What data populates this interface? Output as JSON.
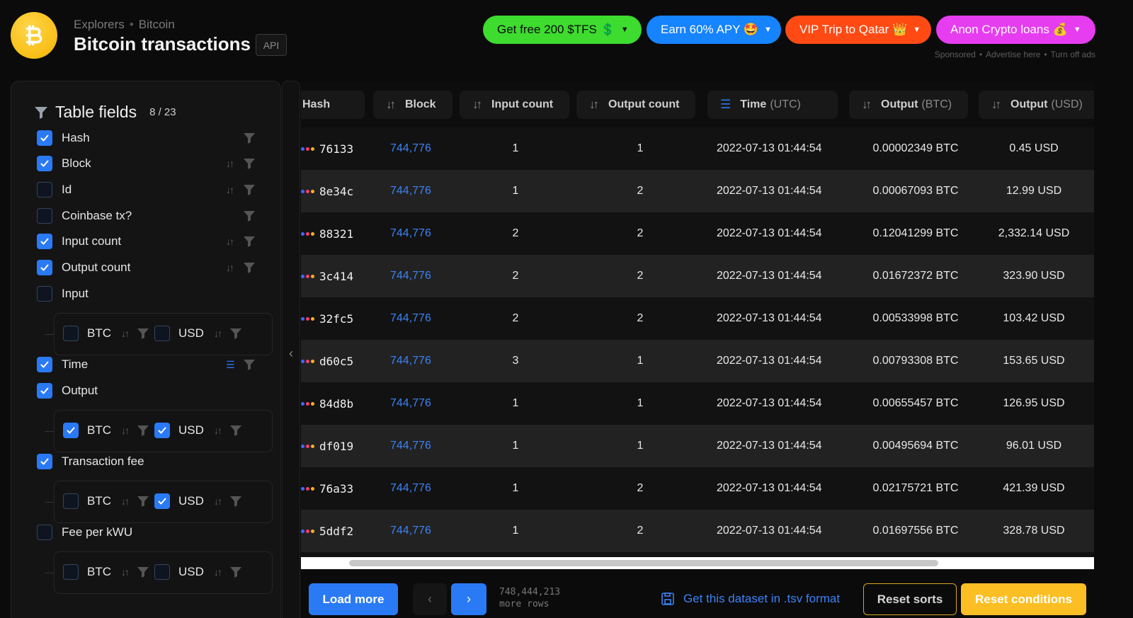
{
  "header": {
    "breadcrumb": [
      "Explorers",
      "Bitcoin"
    ],
    "title": "Bitcoin transactions",
    "api_label": "API"
  },
  "ads": [
    {
      "label": "Get free 200 $TFS 💲",
      "bg": "#3ddc2f",
      "color": "#0b0b0b"
    },
    {
      "label": "Earn 60% APY 🤩",
      "bg": "#1683ff",
      "color": "#ffffff"
    },
    {
      "label": "VIP Trip to Qatar 👑",
      "bg": "#ff4a14",
      "color": "#ffffff"
    },
    {
      "label": "Anon Crypto loans 💰",
      "bg": "#e63df0",
      "color": "#ffffff"
    }
  ],
  "sponsor": {
    "sponsored": "Sponsored",
    "advertise": "Advertise here",
    "turn_off": "Turn off ads"
  },
  "sidebar": {
    "title": "Table fields",
    "count": "8 / 23",
    "fields": [
      {
        "label": "Hash",
        "checked": true
      },
      {
        "label": "Block",
        "checked": true
      },
      {
        "label": "Id",
        "checked": false
      },
      {
        "label": "Coinbase tx?",
        "checked": false
      },
      {
        "label": "Input count",
        "checked": true
      },
      {
        "label": "Output count",
        "checked": true
      },
      {
        "label": "Input",
        "checked": false
      },
      {
        "label": "Time",
        "checked": true
      },
      {
        "label": "Output",
        "checked": true
      },
      {
        "label": "Transaction fee",
        "checked": true
      },
      {
        "label": "Fee per kWU",
        "checked": false
      }
    ],
    "sub_btc": "BTC",
    "sub_usd": "USD"
  },
  "table": {
    "columns": [
      {
        "label": "Hash",
        "unit": ""
      },
      {
        "label": "Block",
        "unit": ""
      },
      {
        "label": "Input count",
        "unit": ""
      },
      {
        "label": "Output count",
        "unit": ""
      },
      {
        "label": "Time",
        "unit": "(UTC)"
      },
      {
        "label": "Output",
        "unit": "(BTC)"
      },
      {
        "label": "Output",
        "unit": "(USD)"
      }
    ],
    "rows": [
      {
        "hash": "76133",
        "block": "744,776",
        "inputs": "1",
        "outputs": "1",
        "time": "2022-07-13 01:44:54",
        "btc": "0.00002349 BTC",
        "usd": "0.45 USD"
      },
      {
        "hash": "8e34c",
        "block": "744,776",
        "inputs": "1",
        "outputs": "2",
        "time": "2022-07-13 01:44:54",
        "btc": "0.00067093 BTC",
        "usd": "12.99 USD"
      },
      {
        "hash": "88321",
        "block": "744,776",
        "inputs": "2",
        "outputs": "2",
        "time": "2022-07-13 01:44:54",
        "btc": "0.12041299 BTC",
        "usd": "2,332.14 USD"
      },
      {
        "hash": "3c414",
        "block": "744,776",
        "inputs": "2",
        "outputs": "2",
        "time": "2022-07-13 01:44:54",
        "btc": "0.01672372 BTC",
        "usd": "323.90 USD"
      },
      {
        "hash": "32fc5",
        "block": "744,776",
        "inputs": "2",
        "outputs": "2",
        "time": "2022-07-13 01:44:54",
        "btc": "0.00533998 BTC",
        "usd": "103.42 USD"
      },
      {
        "hash": "d60c5",
        "block": "744,776",
        "inputs": "3",
        "outputs": "1",
        "time": "2022-07-13 01:44:54",
        "btc": "0.00793308 BTC",
        "usd": "153.65 USD"
      },
      {
        "hash": "84d8b",
        "block": "744,776",
        "inputs": "1",
        "outputs": "1",
        "time": "2022-07-13 01:44:54",
        "btc": "0.00655457 BTC",
        "usd": "126.95 USD"
      },
      {
        "hash": "df019",
        "block": "744,776",
        "inputs": "1",
        "outputs": "1",
        "time": "2022-07-13 01:44:54",
        "btc": "0.00495694 BTC",
        "usd": "96.01 USD"
      },
      {
        "hash": "76a33",
        "block": "744,776",
        "inputs": "1",
        "outputs": "2",
        "time": "2022-07-13 01:44:54",
        "btc": "0.02175721 BTC",
        "usd": "421.39 USD"
      },
      {
        "hash": "5ddf2",
        "block": "744,776",
        "inputs": "1",
        "outputs": "2",
        "time": "2022-07-13 01:44:54",
        "btc": "0.01697556 BTC",
        "usd": "328.78 USD"
      }
    ]
  },
  "footer": {
    "load_more": "Load more",
    "rows_count": "748,444,213",
    "rows_suffix": "more rows",
    "download": "Get this dataset in .tsv format",
    "reset_sorts": "Reset sorts",
    "reset_conditions": "Reset conditions"
  },
  "colors": {
    "accent": "#2a7af5",
    "link": "#3b82f6",
    "warning": "#fbbf24"
  }
}
